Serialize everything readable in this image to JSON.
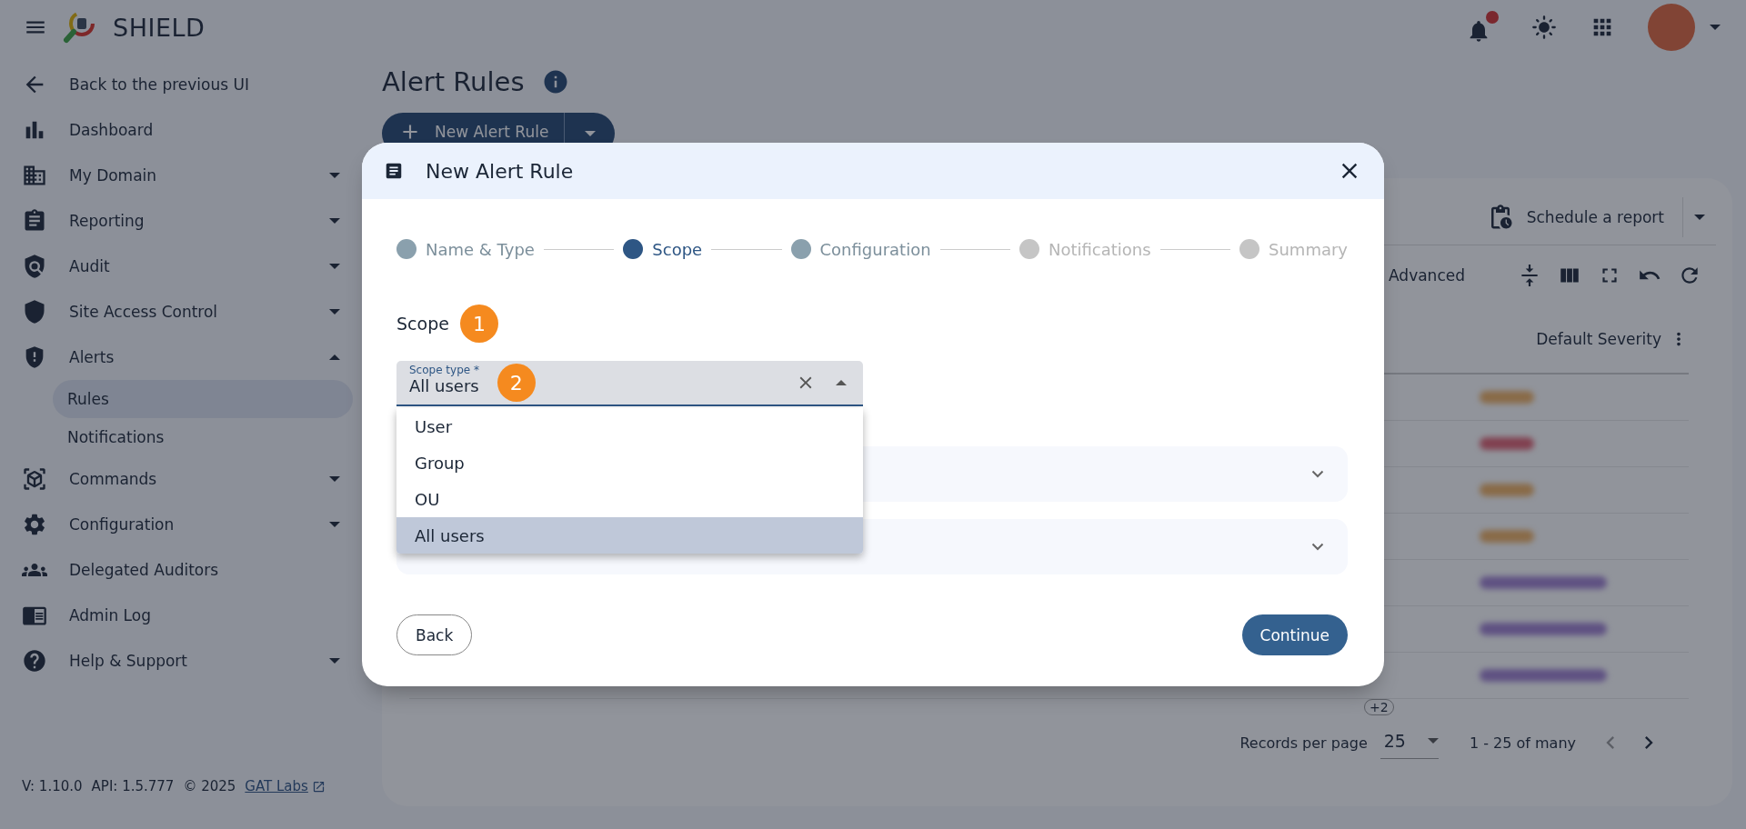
{
  "app": {
    "name": "SHIELD",
    "notifications_unread": true
  },
  "sidebar": {
    "items": [
      {
        "label": "Back to the previous UI"
      },
      {
        "label": "Dashboard"
      },
      {
        "label": "My Domain",
        "expanded": false
      },
      {
        "label": "Reporting",
        "expanded": false
      },
      {
        "label": "Audit",
        "expanded": false
      },
      {
        "label": "Site Access Control",
        "expanded": false
      },
      {
        "label": "Alerts",
        "expanded": true,
        "children": [
          {
            "label": "Rules",
            "selected": true
          },
          {
            "label": "Notifications",
            "selected": false
          }
        ]
      },
      {
        "label": "Commands",
        "expanded": false
      },
      {
        "label": "Configuration",
        "expanded": false
      },
      {
        "label": "Delegated Auditors"
      },
      {
        "label": "Admin Log"
      },
      {
        "label": "Help & Support",
        "expanded": false
      }
    ],
    "footer": {
      "version": "V: 1.10.0",
      "api": "API: 1.5.777",
      "copyright": "© 2025",
      "link": "GAT Labs"
    }
  },
  "page": {
    "title": "Alert Rules",
    "new_button": "New Alert Rule"
  },
  "card": {
    "schedule_button": "Schedule a report",
    "advanced": "Advanced",
    "column_header": "Default Severity",
    "chip": "+2",
    "pagination": {
      "label": "Records per page",
      "per_page": "25",
      "range": "1 - 25 of many"
    }
  },
  "dialog": {
    "title": "New Alert Rule",
    "steps": [
      {
        "label": "Name & Type",
        "visited": true,
        "selected": false
      },
      {
        "label": "Scope",
        "visited": true,
        "selected": true
      },
      {
        "label": "Configuration",
        "visited": true,
        "selected": false
      },
      {
        "label": "Notifications",
        "visited": false,
        "selected": false
      },
      {
        "label": "Summary",
        "visited": false,
        "selected": false
      }
    ],
    "section_label": "Scope",
    "section_marker": "1",
    "select": {
      "label": "Scope type *",
      "value": "All users",
      "marker": "2",
      "open": true,
      "options": [
        {
          "label": "User",
          "selected": false
        },
        {
          "label": "Group",
          "selected": false
        },
        {
          "label": "OU",
          "selected": false
        },
        {
          "label": "All users",
          "selected": true
        }
      ]
    },
    "back_button": "Back",
    "continue_button": "Continue"
  }
}
